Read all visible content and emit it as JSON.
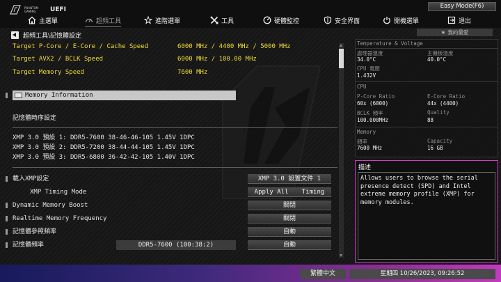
{
  "header": {
    "brand_small": "PHANTOM GAMING",
    "brand_uefi": "UEFI",
    "easy_mode_label": "Easy Mode(F6)",
    "menu": [
      {
        "label": "主選單",
        "icon": "home-icon"
      },
      {
        "label": "超頻工具",
        "icon": "speedometer-icon",
        "active": true
      },
      {
        "label": "進階選單",
        "icon": "star-arrows-icon"
      },
      {
        "label": "工具",
        "icon": "tools-icon"
      },
      {
        "label": "硬體監控",
        "icon": "monitor-gauge-icon"
      },
      {
        "label": "安全界面",
        "icon": "shield-icon"
      },
      {
        "label": "開機選單",
        "icon": "power-icon"
      },
      {
        "label": "退出",
        "icon": "exit-icon"
      }
    ]
  },
  "breadcrumb": "超頻工具\\記憶體設定",
  "favorite_label": "我的最愛",
  "targets": [
    {
      "label": "Target P-Core / E-Core / Cache Speed",
      "value": "6000 MHz / 4400 MHz / 5000 MHz"
    },
    {
      "label": "Target AVX2 / BCLK Speed",
      "value": "6000 MHz / 100.00 MHz"
    },
    {
      "label": "Target Memory Speed",
      "value": "7600 MHz"
    }
  ],
  "selected_item": "Memory Information",
  "timing_section": "記憶體時序設定",
  "xmp_profiles": [
    "XMP 3.0 預設    1: DDR5-7600 38-46-46-105 1.45V 1DPC",
    "XMP 3.0 預設    2: DDR5-7200 38-44-44-105 1.45V 1DPC",
    "XMP 3.0 預設    3: DDR5-6800 36-42-42-105 1.40V 1DPC"
  ],
  "settings": {
    "load_xmp": {
      "label": "載入XMP設定",
      "value": "XMP 3.0 設置文件 1"
    },
    "xmp_timing": {
      "label": "XMP Timing Mode",
      "value_left": "Apply All",
      "value_right": "Timing"
    },
    "dynamic_boost": {
      "label": "Dynamic Memory Boost",
      "value": "關閉"
    },
    "realtime_freq": {
      "label": "Realtime Memory Frequency",
      "value": "關閉"
    },
    "ref_freq": {
      "label": "記憶體參照頻率",
      "value": "自動"
    },
    "mem_freq": {
      "label": "記憶體頻率",
      "field": "DDR5-7600 (100:38:2)",
      "value": "自動"
    }
  },
  "monitor": {
    "temp_header": "Temperature & Voltage",
    "cpu_temp_label": "處理器溫度",
    "cpu_temp": "34.0°C",
    "mb_temp_label": "主機板溫度",
    "mb_temp": "40.0°C",
    "vcore_label": "CPU 電壓",
    "vcore": "1.432V",
    "cpu_header": "CPU",
    "pcore_label": "P-Core Ratio",
    "pcore": "60x (6000)",
    "ecore_label": "E-Core Ratio",
    "ecore": "44x (4400)",
    "bclk_label": "BCLK 頻率",
    "bclk": "100.000MHz",
    "quality_label": "Quality",
    "quality": "88",
    "mem_header": "Memory",
    "freq_label": "頻率",
    "freq": "7600 MHz",
    "cap_label": "Capacity",
    "cap": "16 GB"
  },
  "description": {
    "title": "描述",
    "text": "Allows users to browse the serial presence detect (SPD) and Intel extreme memory profile (XMP) for memory modules."
  },
  "footer": {
    "language": "繁體中文",
    "datetime": "星期四 10/26/2023, 09:26:52"
  },
  "colors": {
    "accent": "#f1dc32",
    "desc_border": "#d23ccd",
    "footer_start": "#171a5c",
    "footer_end": "#c23bc0"
  }
}
